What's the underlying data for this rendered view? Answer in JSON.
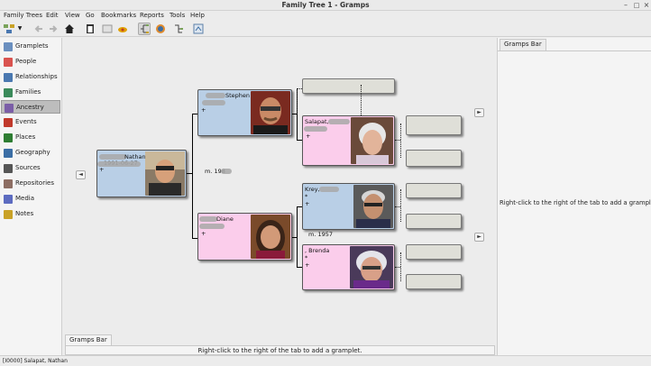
{
  "window": {
    "title": "Family Tree 1 - Gramps",
    "controls": [
      "–",
      "□",
      "×"
    ]
  },
  "menu": [
    "Family Trees",
    "Edit",
    "View",
    "Go",
    "Bookmarks",
    "Reports",
    "Tools",
    "Help"
  ],
  "toolbar": {
    "icons": [
      "family-tree-icon",
      "dropdown-arrow-icon",
      "back-arrow-icon",
      "forward-arrow-icon",
      "home-icon",
      "clipboard-icon",
      "edit-icon",
      "bookmark-icon",
      "pedigree-view-icon",
      "fan-chart-icon",
      "descendant-icon",
      "configure-view-icon"
    ]
  },
  "sidebar": {
    "items": [
      {
        "label": "Gramplets",
        "icon": "gramplets-icon",
        "color": "#6a8fbf"
      },
      {
        "label": "People",
        "icon": "people-icon",
        "color": "#d9534f"
      },
      {
        "label": "Relationships",
        "icon": "relationships-icon",
        "color": "#4a78b0"
      },
      {
        "label": "Families",
        "icon": "families-icon",
        "color": "#3a8a5a"
      },
      {
        "label": "Ancestry",
        "icon": "ancestry-icon",
        "color": "#7b5ea7"
      },
      {
        "label": "Events",
        "icon": "events-icon",
        "color": "#c0392b"
      },
      {
        "label": "Places",
        "icon": "places-icon",
        "color": "#2e7d32"
      },
      {
        "label": "Geography",
        "icon": "geography-icon",
        "color": "#3b6ea5"
      },
      {
        "label": "Sources",
        "icon": "sources-icon",
        "color": "#555555"
      },
      {
        "label": "Repositories",
        "icon": "repositories-icon",
        "color": "#8d6e63"
      },
      {
        "label": "Media",
        "icon": "media-icon",
        "color": "#5c6bc0"
      },
      {
        "label": "Notes",
        "icon": "notes-icon",
        "color": "#c9a227"
      }
    ],
    "selected": "Ancestry"
  },
  "pedigree": {
    "root": {
      "name": "Nathan",
      "birth": "1991-06-27",
      "marker": "+"
    },
    "father": {
      "name": "Stephen",
      "marker": "+"
    },
    "mother": {
      "name": "Diane",
      "marker": "+"
    },
    "parents_marriage": "m. 198",
    "paternal_grandmother": {
      "name": "Salapat,",
      "marker": "+"
    },
    "maternal_grandfather": {
      "name": "Krey,",
      "markers": [
        "*",
        "+"
      ]
    },
    "maternal_grandmother": {
      "name": ", Brenda",
      "markers": [
        "*",
        "+"
      ]
    },
    "grandparents_marriage": "m. 1957",
    "back_arrow": "◄",
    "forward_arrow": "►"
  },
  "bottom": {
    "tab": "Gramps Bar",
    "hint": "Right-click to the right of the tab to add a gramplet."
  },
  "right_panel": {
    "tab": "Gramps Bar",
    "hint": "Right-click to the right of the tab to add a gramplet."
  },
  "status": "[I0000] Salapat, Nathan"
}
